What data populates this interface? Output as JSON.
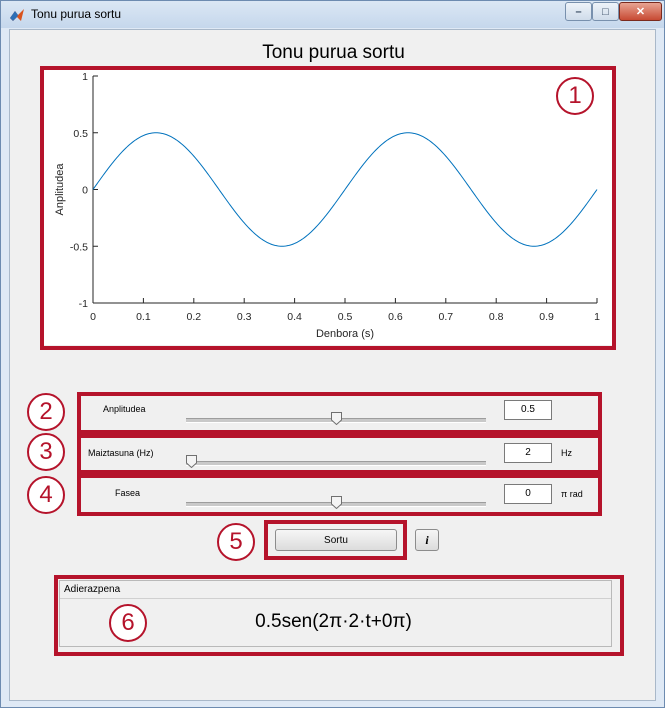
{
  "window": {
    "title": "Tonu purua sortu",
    "minimize": "–",
    "maximize": "□",
    "close": "✕"
  },
  "figure": {
    "title": "Tonu purua sortu"
  },
  "chart_data": {
    "type": "line",
    "xlabel": "Denbora (s)",
    "ylabel": "Anplitudea",
    "xlim": [
      0,
      1
    ],
    "ylim": [
      -1,
      1
    ],
    "xticks": [
      "0",
      "0.1",
      "0.2",
      "0.3",
      "0.4",
      "0.5",
      "0.6",
      "0.7",
      "0.8",
      "0.9",
      "1"
    ],
    "yticks": [
      "1",
      "0.5",
      "0",
      "-0.5",
      "-1"
    ],
    "series": [
      {
        "amplitude": 0.5,
        "frequency_hz": 2,
        "phase_pi_rad": 0,
        "color": "#0072bd"
      }
    ]
  },
  "controls": {
    "amplitude": {
      "label": "Anplitudea",
      "value": "0.5",
      "slider": 0.5
    },
    "frequency": {
      "label": "Maiztasuna (Hz)",
      "value": "2",
      "unit": "Hz",
      "slider": 0.0
    },
    "phase": {
      "label": "Fasea",
      "value": "0",
      "unit": "π rad",
      "slider": 0.5
    },
    "generate_button": "Sortu",
    "info_button": "i"
  },
  "expression_panel": {
    "title": "Adierazpena",
    "expression": "0.5sen(2π·2·t+0π)"
  },
  "annotations": [
    "1",
    "2",
    "3",
    "4",
    "5",
    "6"
  ],
  "colors": {
    "annotation": "#b5132b",
    "line": "#0072bd"
  }
}
